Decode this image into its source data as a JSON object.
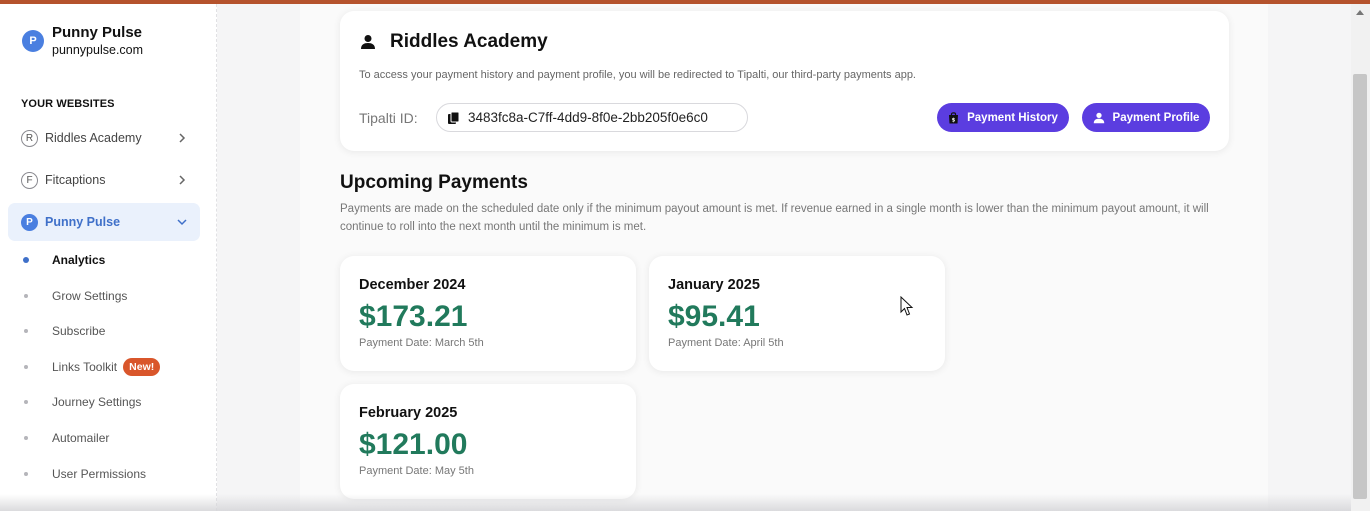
{
  "brand": {
    "initial": "P",
    "name": "Punny Pulse",
    "url": "punnypulse.com"
  },
  "sidebar": {
    "section_title": "YOUR WEBSITES",
    "sites": [
      {
        "initial": "R",
        "label": "Riddles Academy"
      },
      {
        "initial": "F",
        "label": "Fitcaptions"
      },
      {
        "initial": "P",
        "label": "Punny Pulse"
      }
    ],
    "sub_items": [
      {
        "label": "Analytics"
      },
      {
        "label": "Grow Settings"
      },
      {
        "label": "Subscribe"
      },
      {
        "label": "Links Toolkit",
        "badge": "New!"
      },
      {
        "label": "Journey Settings"
      },
      {
        "label": "Automailer"
      },
      {
        "label": "User Permissions"
      }
    ]
  },
  "profile": {
    "title": "Riddles Academy",
    "description": "To access your payment history and payment profile, you will be redirected to Tipalti, our third-party payments app.",
    "tipalti_label": "Tipalti ID:",
    "tipalti_id": "3483fc8a-C7ff-4dd9-8f0e-2bb205f0e6c0",
    "history_button": "Payment History",
    "profile_button": "Payment Profile"
  },
  "upcoming": {
    "heading": "Upcoming Payments",
    "description": "Payments are made on the scheduled date only if the minimum payout amount is met. If revenue earned in a single month is lower than the minimum payout amount, it will continue to roll into the next month until the minimum is met.",
    "payments": [
      {
        "month": "December 2024",
        "amount": "$173.21",
        "date": "Payment Date: March 5th"
      },
      {
        "month": "January 2025",
        "amount": "$95.41",
        "date": "Payment Date: April 5th"
      },
      {
        "month": "February 2025",
        "amount": "$121.00",
        "date": "Payment Date: May 5th"
      }
    ]
  },
  "colors": {
    "accent": "#5b3de0",
    "money": "#217a5c",
    "brand_blue": "#4a7fe0",
    "badge_orange": "#d9562b",
    "top_bar": "#b5532d"
  }
}
